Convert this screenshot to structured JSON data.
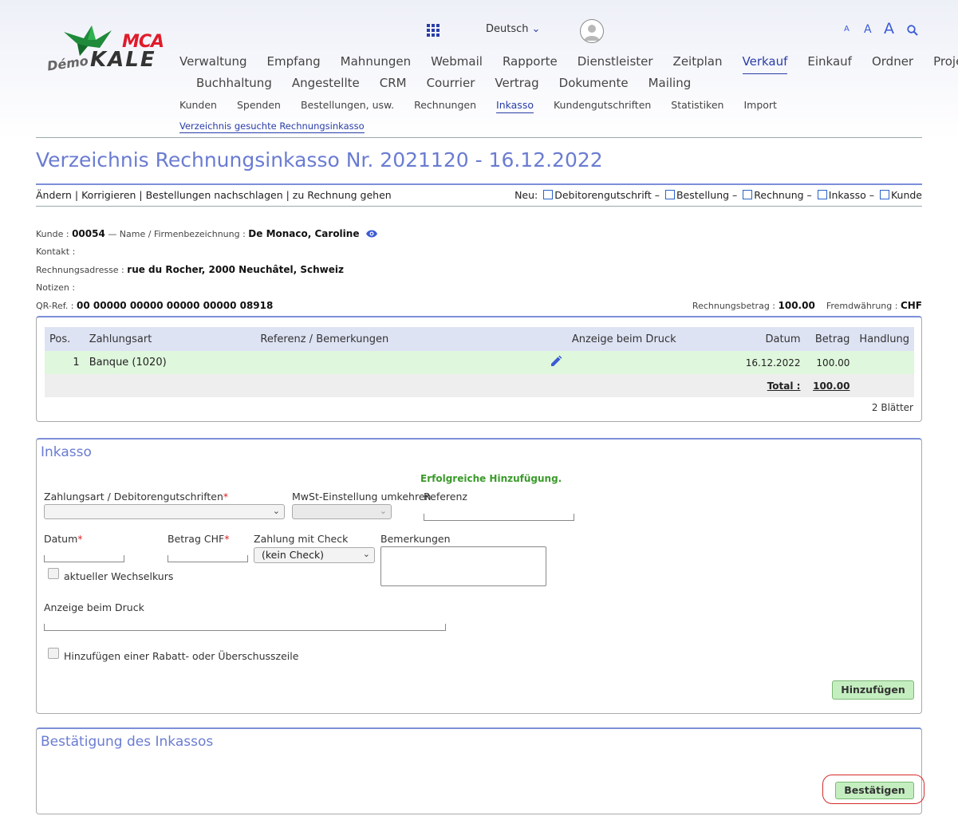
{
  "app": {
    "logo_brand": "MCA",
    "logo_name": "KALE",
    "logo_prefix": "Démo",
    "language": "Deutsch",
    "font_sizes": [
      "A",
      "A",
      "A"
    ]
  },
  "nav": {
    "main_row1": [
      "Verwaltung",
      "Empfang",
      "Mahnungen",
      "Webmail",
      "Rapporte",
      "Dienstleister",
      "Zeitplan",
      "Verkauf",
      "Einkauf",
      "Ordner",
      "Projekte"
    ],
    "main_row2": [
      "Buchhaltung",
      "Angestellte",
      "CRM",
      "Courrier",
      "Vertrag",
      "Dokumente",
      "Mailing"
    ],
    "active_main": "Verkauf",
    "sub": [
      "Kunden",
      "Spenden",
      "Bestellungen, usw.",
      "Rechnungen",
      "Inkasso",
      "Kundengutschriften",
      "Statistiken",
      "Import"
    ],
    "active_sub": "Inkasso",
    "subsub": "Verzeichnis gesuchte Rechnungsinkasso"
  },
  "page": {
    "title": "Verzeichnis Rechnungsinkasso Nr. 2021120 - 16.12.2022",
    "actions": "Ändern | Korrigieren | Bestellungen nachschlagen | zu Rechnung gehen",
    "neu_label": "Neu:",
    "neu_links": [
      "Debitorengutschrift",
      "Bestellung",
      "Rechnung",
      "Inkasso",
      "Kunde"
    ]
  },
  "customer": {
    "kunde_label": "Kunde :",
    "kunde_value": "00054",
    "name_label": "— Name / Firmenbezeichnung :",
    "name_value": "De Monaco, Caroline",
    "kontakt_label": "Kontakt :",
    "adresse_label": "Rechnungsadresse :",
    "adresse_value": "rue du Rocher, 2000 Neuchâtel, Schweiz",
    "notizen_label": "Notizen :",
    "qr_label": "QR-Ref. :",
    "qr_value": "00 00000 00000 00000 00000 08918",
    "betrag_label": "Rechnungsbetrag :",
    "betrag_value": "100.00",
    "fremd_label": "Fremdwährung :",
    "fremd_value": "CHF"
  },
  "payments_table": {
    "headers": [
      "Pos.",
      "Zahlungsart",
      "Referenz / Bemerkungen",
      "Anzeige beim Druck",
      "Datum",
      "Betrag",
      "Handlung"
    ],
    "rows": [
      {
        "pos": "1",
        "zahlungsart": "Banque (1020)",
        "referenz": "",
        "anzeige": "",
        "datum": "16.12.2022",
        "betrag": "100.00",
        "handlung": ""
      }
    ],
    "total_label": "Total :",
    "total_value": "100.00",
    "pages": "2 Blätter"
  },
  "inkasso_form": {
    "title": "Inkasso",
    "success": "Erfolgreiche Hinzufügung.",
    "zahlungsart_label": "Zahlungsart / Debitorengutschriften",
    "mwst_label": "MwSt-Einstellung umkehren",
    "referenz_label": "Referenz",
    "datum_label": "Datum",
    "betrag_label": "Betrag CHF",
    "check_label": "Zahlung mit Check",
    "check_value": "(kein Check)",
    "bemerkungen_label": "Bemerkungen",
    "wechselkurs_label": "aktueller Wechselkurs",
    "anzeige_label": "Anzeige beim Druck",
    "rabatt_label": "Hinzufügen einer Rabatt- oder Überschusszeile",
    "required_mark": "*",
    "add_button": "Hinzufügen"
  },
  "confirm": {
    "title": "Bestätigung des Inkassos",
    "button": "Bestätigen"
  },
  "colors": {
    "accent": "#2a3da8",
    "title": "#6a7cd1",
    "success": "#3a9a2a",
    "button_green": "#c4eec0",
    "highlight": "#d62b2b"
  }
}
